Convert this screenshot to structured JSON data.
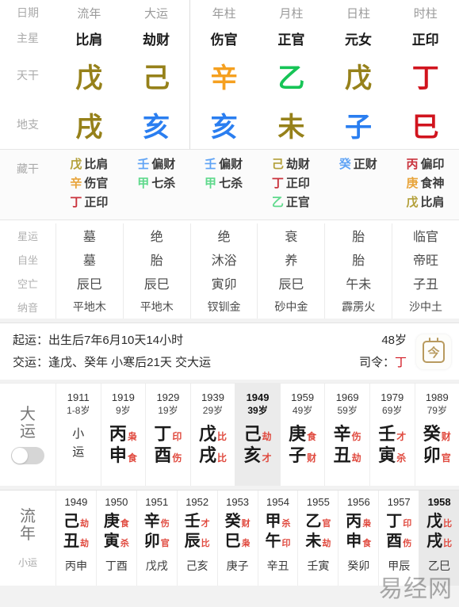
{
  "colors": {
    "wood": "#16c456",
    "wood_soft": "#5fd98c",
    "fire": "#d1141e",
    "fire_soft": "#c9323c",
    "earth": "#96811a",
    "earth_soft": "#b3a03a",
    "metal": "#f5a020",
    "metal_soft": "#e8a43a",
    "water": "#2a7ef0",
    "water_soft": "#5fa3f5",
    "accent_red": "#e04a3f",
    "label_gray": "#aaaaaa",
    "highlight_bg": "#ebebeb"
  },
  "main_table": {
    "row_labels": {
      "date": "日期",
      "zhuxing": "主星",
      "tiangan": "天干",
      "dizhi": "地支",
      "canggan": "藏干",
      "xingyun": "星运",
      "zizuo": "自坐",
      "kongwang": "空亡",
      "nayin": "纳音"
    },
    "columns": [
      {
        "head": "流年",
        "zhuxing": "比肩",
        "gan": "戊",
        "gan_color": "#96811a",
        "zhi": "戌",
        "zhi_color": "#96811a",
        "canggan": [
          {
            "gan": "戊",
            "color": "#b3a03a",
            "star": "比肩"
          },
          {
            "gan": "辛",
            "color": "#e8a43a",
            "star": "伤官"
          },
          {
            "gan": "丁",
            "color": "#c9323c",
            "star": "正印"
          }
        ],
        "xingyun": "墓",
        "zizuo": "墓",
        "kongwang": "辰巳",
        "nayin": "平地木"
      },
      {
        "head": "大运",
        "zhuxing": "劫财",
        "gan": "己",
        "gan_color": "#96811a",
        "zhi": "亥",
        "zhi_color": "#2a7ef0",
        "canggan": [
          {
            "gan": "壬",
            "color": "#5fa3f5",
            "star": "偏财"
          },
          {
            "gan": "甲",
            "color": "#5fd98c",
            "star": "七杀"
          }
        ],
        "xingyun": "绝",
        "zizuo": "胎",
        "kongwang": "辰巳",
        "nayin": "平地木"
      },
      {
        "head": "年柱",
        "zhuxing": "伤官",
        "gan": "辛",
        "gan_color": "#f5a020",
        "zhi": "亥",
        "zhi_color": "#2a7ef0",
        "canggan": [
          {
            "gan": "壬",
            "color": "#5fa3f5",
            "star": "偏财"
          },
          {
            "gan": "甲",
            "color": "#5fd98c",
            "star": "七杀"
          }
        ],
        "xingyun": "绝",
        "zizuo": "沐浴",
        "kongwang": "寅卯",
        "nayin": "钗钏金"
      },
      {
        "head": "月柱",
        "zhuxing": "正官",
        "gan": "乙",
        "gan_color": "#16c456",
        "zhi": "未",
        "zhi_color": "#96811a",
        "canggan": [
          {
            "gan": "己",
            "color": "#b3a03a",
            "star": "劫财"
          },
          {
            "gan": "丁",
            "color": "#c9323c",
            "star": "正印"
          },
          {
            "gan": "乙",
            "color": "#5fd98c",
            "star": "正官"
          }
        ],
        "xingyun": "衰",
        "zizuo": "养",
        "kongwang": "辰巳",
        "nayin": "砂中金"
      },
      {
        "head": "日柱",
        "zhuxing": "元女",
        "gan": "戊",
        "gan_color": "#96811a",
        "zhi": "子",
        "zhi_color": "#2a7ef0",
        "canggan": [
          {
            "gan": "癸",
            "color": "#5fa3f5",
            "star": "正财"
          }
        ],
        "xingyun": "胎",
        "zizuo": "胎",
        "kongwang": "午未",
        "nayin": "霹雳火"
      },
      {
        "head": "时柱",
        "zhuxing": "正印",
        "gan": "丁",
        "gan_color": "#d1141e",
        "zhi": "巳",
        "zhi_color": "#d1141e",
        "canggan": [
          {
            "gan": "丙",
            "color": "#c9323c",
            "star": "偏印"
          },
          {
            "gan": "庚",
            "color": "#e8a43a",
            "star": "食神"
          },
          {
            "gan": "戊",
            "color": "#b3a03a",
            "star": "比肩"
          }
        ],
        "xingyun": "临官",
        "zizuo": "帝旺",
        "kongwang": "子丑",
        "nayin": "沙中土"
      }
    ]
  },
  "qiyun": {
    "line1_label": "起运：",
    "line1_value": "出生后7年6月10天14小时",
    "line2_label": "交运：",
    "line2_value": "逢戊、癸年 小寒后21天 交大运",
    "age": "48岁",
    "siling_label": "司令：",
    "siling_value": "丁",
    "siling_color": "#d1141e",
    "calendar_icon_text": "今"
  },
  "dayun": {
    "label": "大运",
    "toggle_on": false,
    "columns": [
      {
        "year": "1911",
        "age": "1-8岁",
        "xiaoyun_only": true,
        "xiaoyun_line1": "小",
        "xiaoyun_line2": "运",
        "active": false
      },
      {
        "year": "1919",
        "age": "9岁",
        "gan": "丙",
        "gan_star": "枭",
        "zhi": "申",
        "zhi_star": "食",
        "active": false
      },
      {
        "year": "1929",
        "age": "19岁",
        "gan": "丁",
        "gan_star": "印",
        "zhi": "酉",
        "zhi_star": "伤",
        "active": false
      },
      {
        "year": "1939",
        "age": "29岁",
        "gan": "戊",
        "gan_star": "比",
        "zhi": "戌",
        "zhi_star": "比",
        "active": false
      },
      {
        "year": "1949",
        "age": "39岁",
        "gan": "己",
        "gan_star": "劫",
        "zhi": "亥",
        "zhi_star": "才",
        "active": true
      },
      {
        "year": "1959",
        "age": "49岁",
        "gan": "庚",
        "gan_star": "食",
        "zhi": "子",
        "zhi_star": "财",
        "active": false
      },
      {
        "year": "1969",
        "age": "59岁",
        "gan": "辛",
        "gan_star": "伤",
        "zhi": "丑",
        "zhi_star": "劫",
        "active": false
      },
      {
        "year": "1979",
        "age": "69岁",
        "gan": "壬",
        "gan_star": "才",
        "zhi": "寅",
        "zhi_star": "杀",
        "active": false
      },
      {
        "year": "1989",
        "age": "79岁",
        "gan": "癸",
        "gan_star": "财",
        "zhi": "卯",
        "zhi_star": "官",
        "active": false
      }
    ]
  },
  "liunian": {
    "label": "流年",
    "sub_label": "小运",
    "columns": [
      {
        "year": "1949",
        "gan": "己",
        "gan_star": "劫",
        "zhi": "丑",
        "zhi_star": "劫",
        "xiaoyun": "丙申",
        "active": false
      },
      {
        "year": "1950",
        "gan": "庚",
        "gan_star": "食",
        "zhi": "寅",
        "zhi_star": "杀",
        "xiaoyun": "丁酉",
        "active": false
      },
      {
        "year": "1951",
        "gan": "辛",
        "gan_star": "伤",
        "zhi": "卯",
        "zhi_star": "官",
        "xiaoyun": "戊戌",
        "active": false
      },
      {
        "year": "1952",
        "gan": "壬",
        "gan_star": "才",
        "zhi": "辰",
        "zhi_star": "比",
        "xiaoyun": "己亥",
        "active": false
      },
      {
        "year": "1953",
        "gan": "癸",
        "gan_star": "财",
        "zhi": "巳",
        "zhi_star": "枭",
        "xiaoyun": "庚子",
        "active": false
      },
      {
        "year": "1954",
        "gan": "甲",
        "gan_star": "杀",
        "zhi": "午",
        "zhi_star": "印",
        "xiaoyun": "辛丑",
        "active": false
      },
      {
        "year": "1955",
        "gan": "乙",
        "gan_star": "官",
        "zhi": "未",
        "zhi_star": "劫",
        "xiaoyun": "壬寅",
        "active": false
      },
      {
        "year": "1956",
        "gan": "丙",
        "gan_star": "枭",
        "zhi": "申",
        "zhi_star": "食",
        "xiaoyun": "癸卯",
        "active": false
      },
      {
        "year": "1957",
        "gan": "丁",
        "gan_star": "印",
        "zhi": "酉",
        "zhi_star": "伤",
        "xiaoyun": "甲辰",
        "active": false
      },
      {
        "year": "1958",
        "gan": "戊",
        "gan_star": "比",
        "zhi": "戌",
        "zhi_star": "比",
        "xiaoyun": "乙巳",
        "active": true
      }
    ]
  },
  "watermark": "易经网"
}
